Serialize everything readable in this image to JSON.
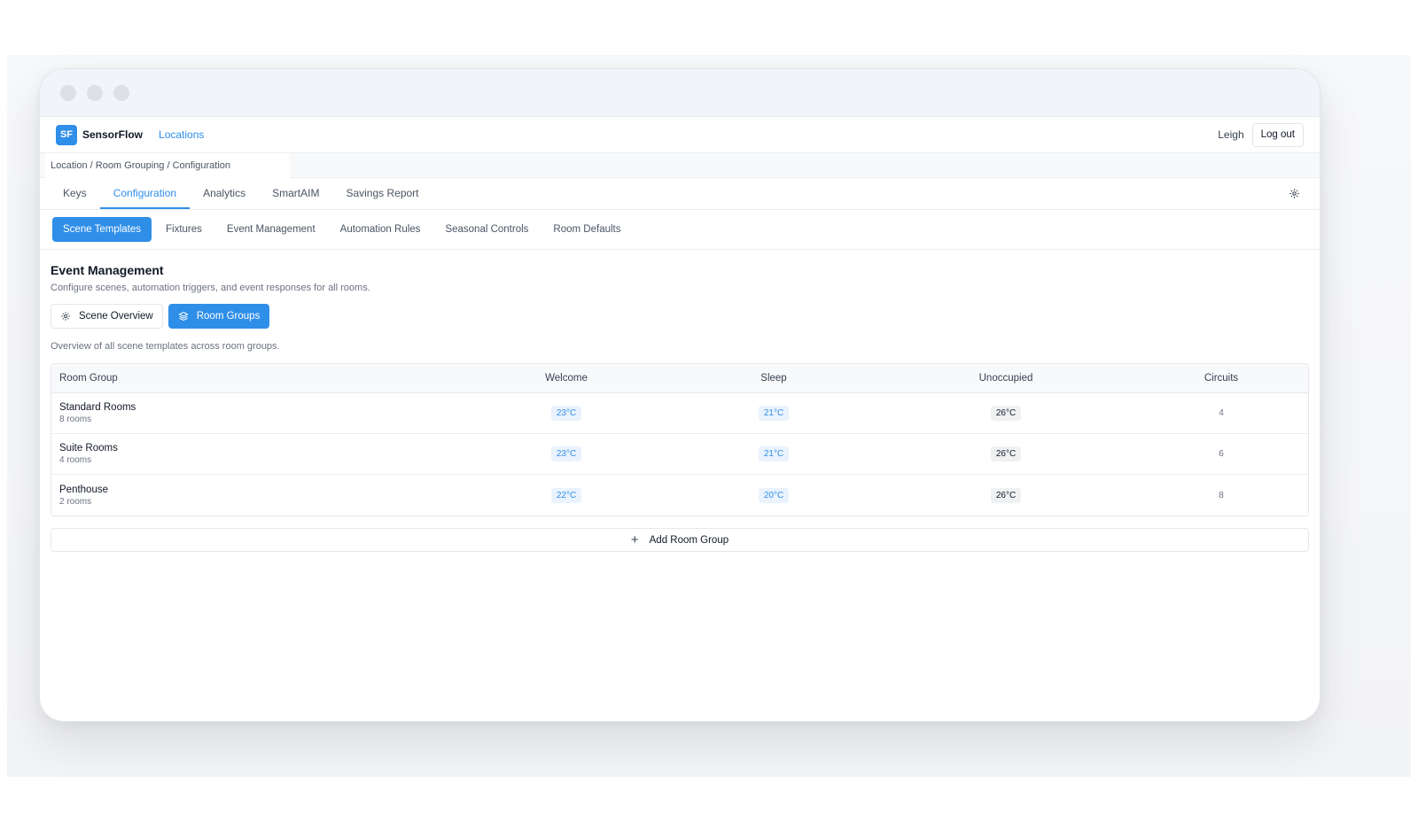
{
  "app": {
    "logo": "SF",
    "brand": "SensorFlow",
    "nav_link": "Locations",
    "user": "Leigh",
    "logout_label": "Log out"
  },
  "breadcrumb": "Location / Room Grouping / Configuration",
  "tabs": [
    {
      "label": "Keys",
      "active": false
    },
    {
      "label": "Configuration",
      "active": true
    },
    {
      "label": "Analytics",
      "active": false
    },
    {
      "label": "SmartAIM",
      "active": false
    },
    {
      "label": "Savings Report",
      "active": false
    }
  ],
  "subtabs": [
    {
      "label": "Scene Templates",
      "active": true
    },
    {
      "label": "Fixtures",
      "active": false
    },
    {
      "label": "Event Management",
      "active": false
    },
    {
      "label": "Automation Rules",
      "active": false
    },
    {
      "label": "Seasonal Controls",
      "active": false
    },
    {
      "label": "Room Defaults",
      "active": false
    }
  ],
  "page": {
    "title": "Event Management",
    "subtitle": "Configure scenes, automation triggers, and event responses for all rooms.",
    "scene_overview_label": "Scene Overview",
    "room_groups_label": "Room Groups",
    "overview_text": "Overview of all scene templates across room groups."
  },
  "table": {
    "headers": [
      "Room Group",
      "Welcome",
      "Sleep",
      "Unoccupied",
      "Circuits"
    ],
    "rows": [
      {
        "name": "Standard Rooms",
        "count": "8 rooms",
        "welcome": "23°C",
        "sleep": "21°C",
        "unoccupied": "26°C",
        "circuits": "4"
      },
      {
        "name": "Suite Rooms",
        "count": "4 rooms",
        "welcome": "23°C",
        "sleep": "21°C",
        "unoccupied": "26°C",
        "circuits": "6"
      },
      {
        "name": "Penthouse",
        "count": "2 rooms",
        "welcome": "22°C",
        "sleep": "20°C",
        "unoccupied": "26°C",
        "circuits": "8"
      }
    ]
  },
  "add_group_label": "Add Room Group",
  "colors": {
    "accent": "#2f8ee8",
    "badge_bg": "#eaf3fd",
    "neutral_badge_bg": "#f0f1f3"
  }
}
